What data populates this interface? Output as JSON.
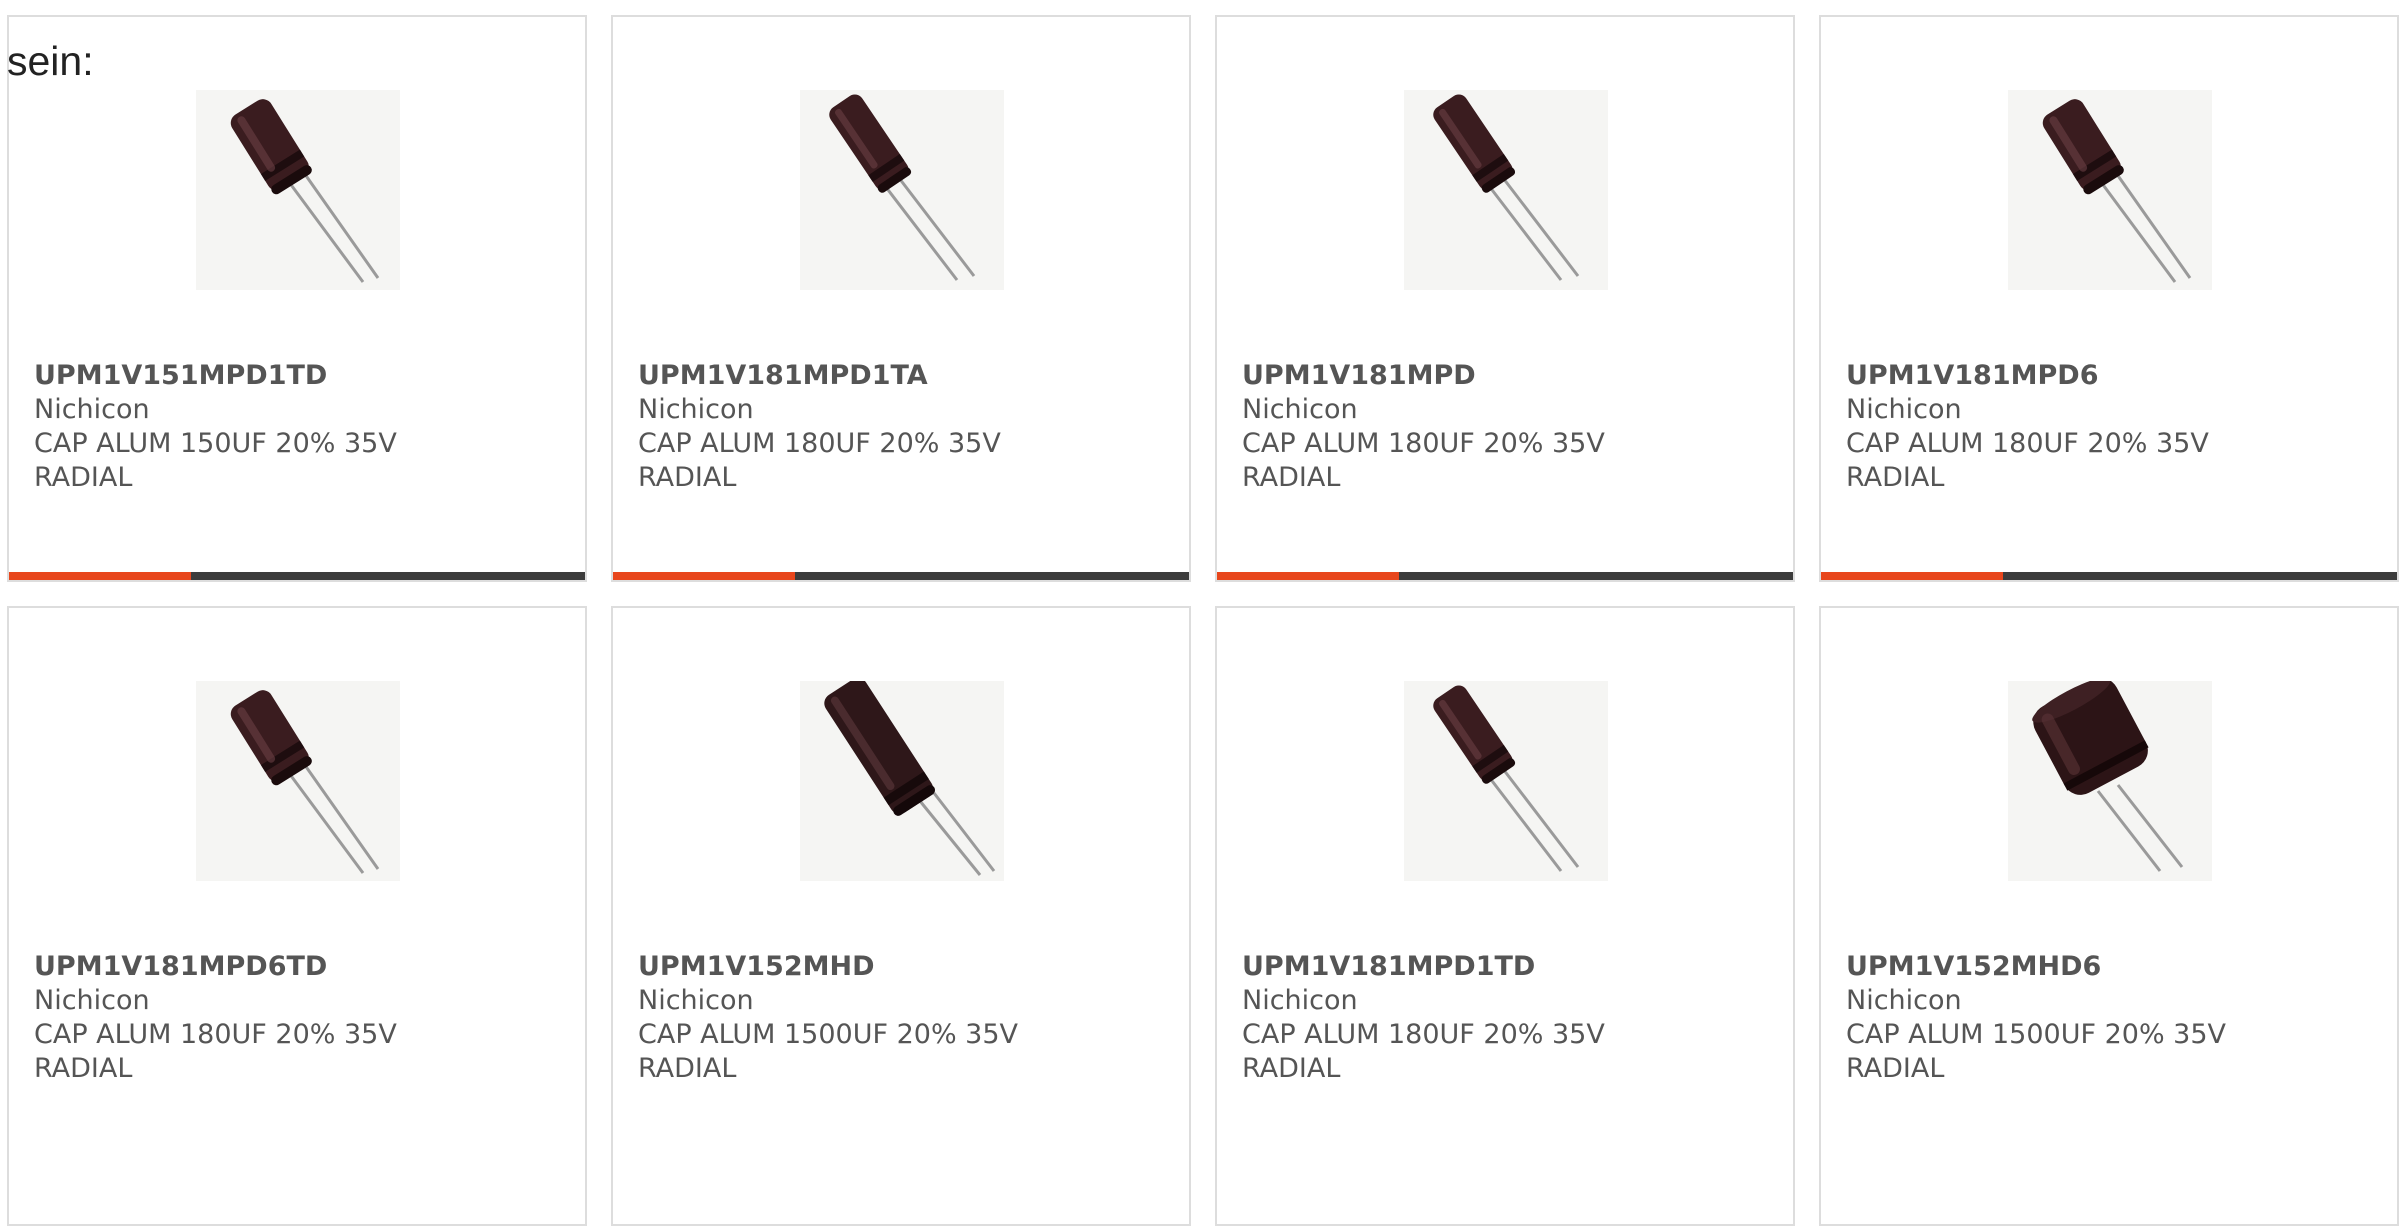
{
  "page_lead": "sein:",
  "accent_color": "#e8461c",
  "bar_color": "#3c3c3c",
  "products": [
    {
      "part_number": "UPM1V151MPD1TD",
      "manufacturer": "Nichicon",
      "description": "CAP ALUM 150UF 20% 35V RADIAL",
      "image": "capacitor-radial-small"
    },
    {
      "part_number": "UPM1V181MPD1TA",
      "manufacturer": "Nichicon",
      "description": "CAP ALUM 180UF 20% 35V RADIAL",
      "image": "capacitor-radial-slim"
    },
    {
      "part_number": "UPM1V181MPD",
      "manufacturer": "Nichicon",
      "description": "CAP ALUM 180UF 20% 35V RADIAL",
      "image": "capacitor-radial-slim"
    },
    {
      "part_number": "UPM1V181MPD6",
      "manufacturer": "Nichicon",
      "description": "CAP ALUM 180UF 20% 35V RADIAL",
      "image": "capacitor-radial-small"
    },
    {
      "part_number": "UPM1V181MPD6TD",
      "manufacturer": "Nichicon",
      "description": "CAP ALUM 180UF 20% 35V RADIAL",
      "image": "capacitor-radial-small"
    },
    {
      "part_number": "UPM1V152MHD",
      "manufacturer": "Nichicon",
      "description": "CAP ALUM 1500UF 20% 35V RADIAL",
      "image": "capacitor-radial-long"
    },
    {
      "part_number": "UPM1V181MPD1TD",
      "manufacturer": "Nichicon",
      "description": "CAP ALUM 180UF 20% 35V RADIAL",
      "image": "capacitor-radial-slim"
    },
    {
      "part_number": "UPM1V152MHD6",
      "manufacturer": "Nichicon",
      "description": "CAP ALUM 1500UF 20% 35V RADIAL",
      "image": "capacitor-radial-wide"
    }
  ]
}
